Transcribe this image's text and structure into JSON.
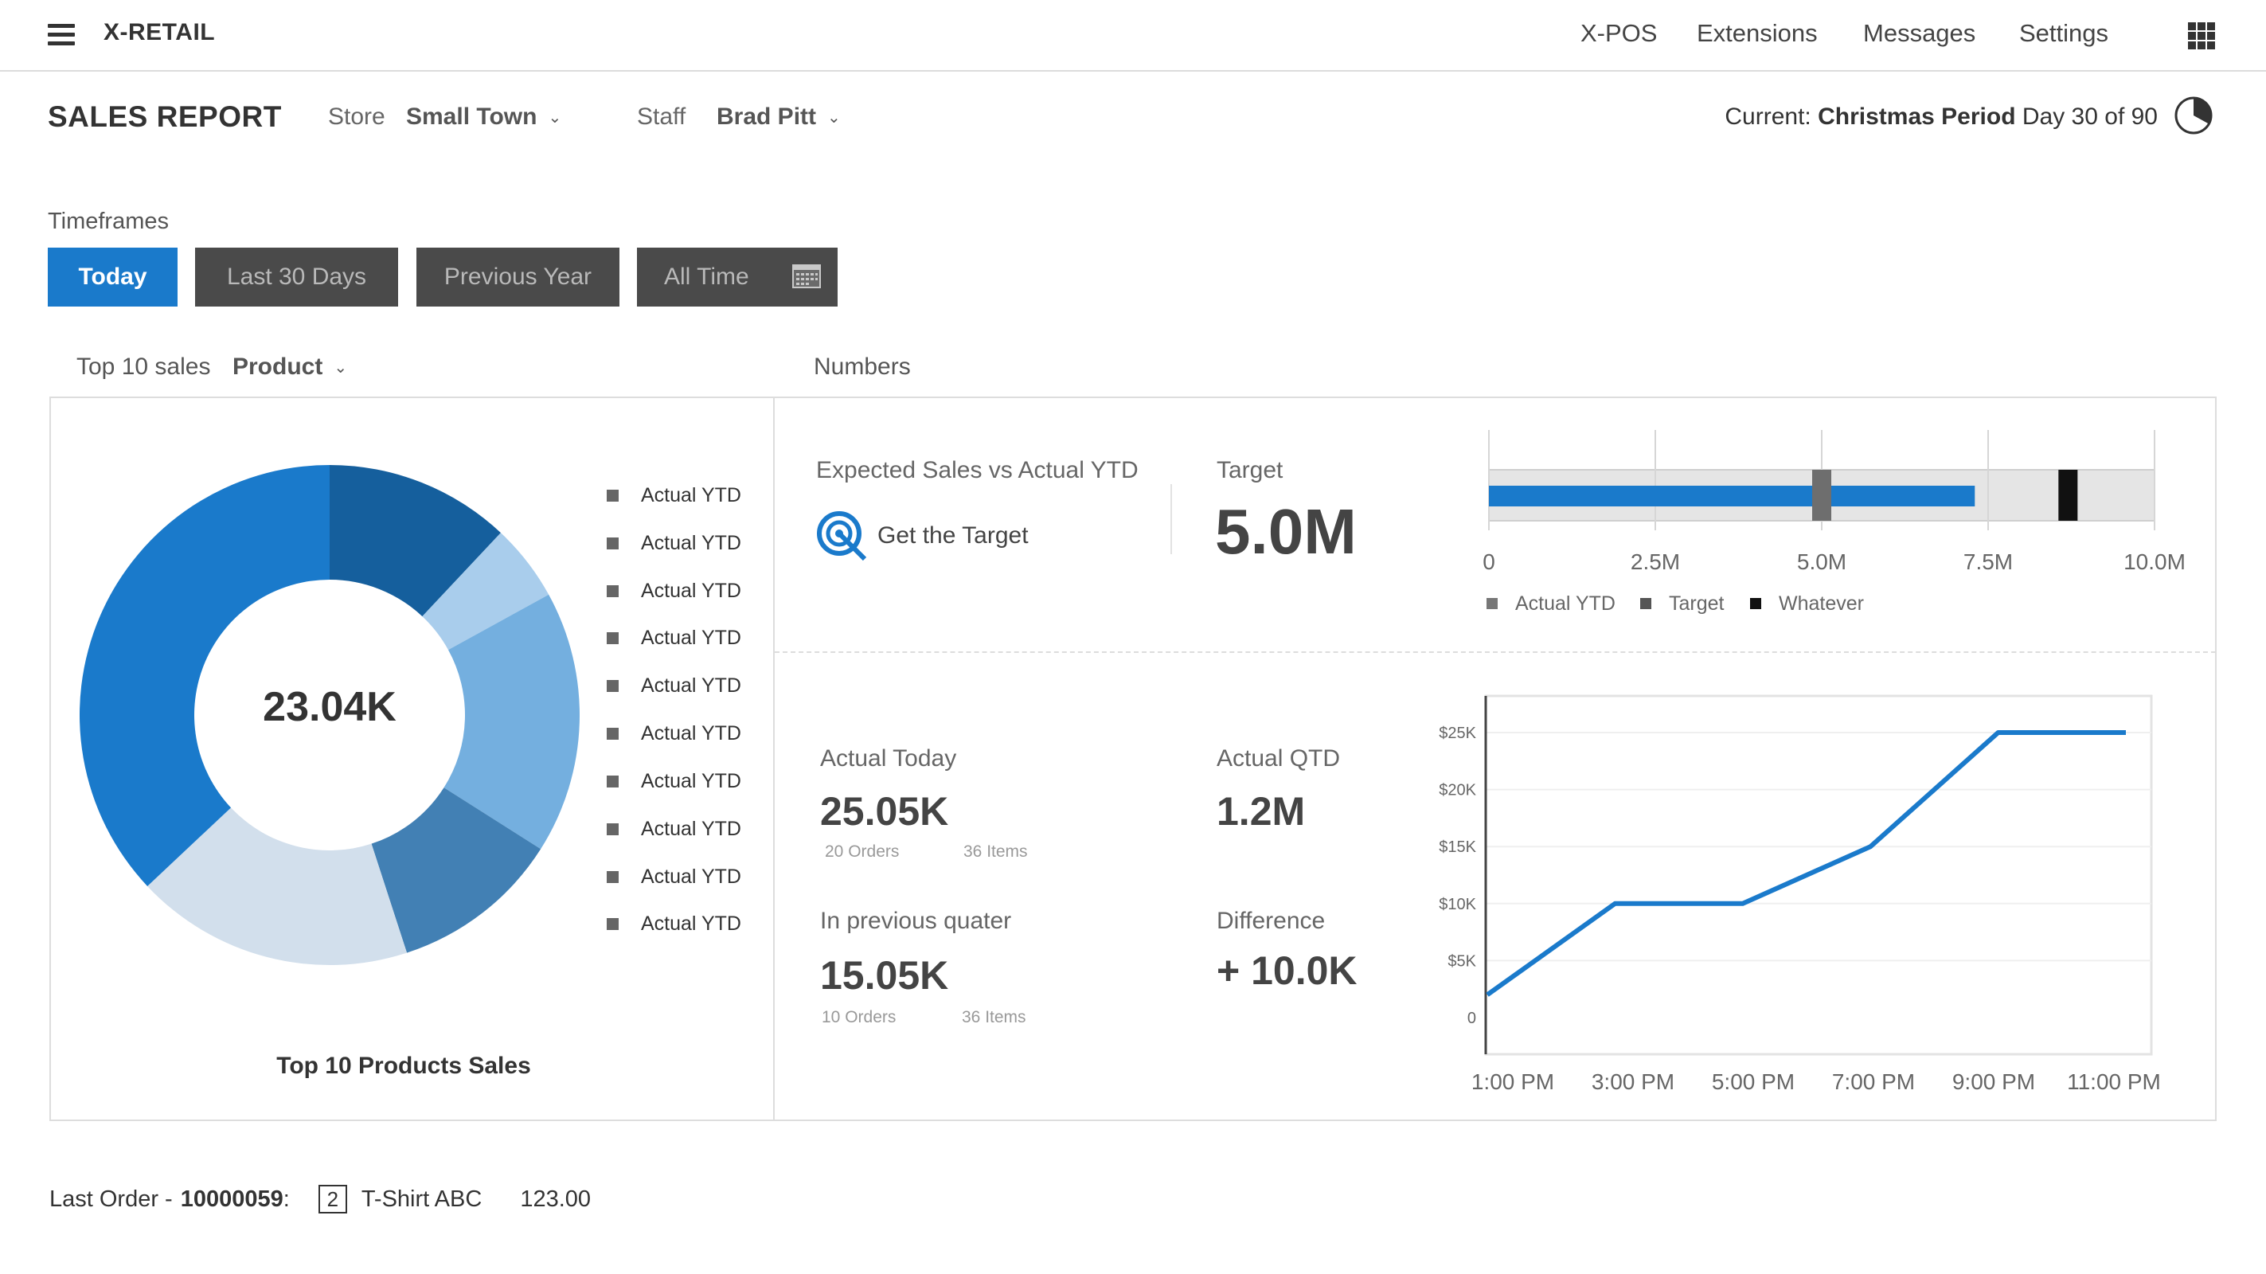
{
  "app": {
    "brand": "X-RETAIL",
    "nav": [
      "X-POS",
      "Extensions",
      "Messages",
      "Settings"
    ]
  },
  "header": {
    "title": "SALES REPORT",
    "store_label": "Store",
    "store_value": "Small Town",
    "staff_label": "Staff",
    "staff_value": "Brad Pitt",
    "current_prefix": "Current:",
    "current_period": "Christmas Period",
    "current_day": "Day 30 of 90",
    "period_progress": 0.33
  },
  "timeframes": {
    "label": "Timeframes",
    "buttons": [
      "Today",
      "Last 30 Days",
      "Previous Year",
      "All Time"
    ],
    "active": "Today"
  },
  "top_sales": {
    "label": "Top 10 sales",
    "dimension": "Product",
    "center_value": "23.04K",
    "caption": "Top 10 Products Sales",
    "legend": [
      "Actual YTD",
      "Actual YTD",
      "Actual YTD",
      "Actual YTD",
      "Actual YTD",
      "Actual YTD",
      "Actual YTD",
      "Actual YTD",
      "Actual YTD",
      "Actual YTD"
    ]
  },
  "numbers": {
    "label": "Numbers",
    "expected_label": "Expected Sales vs Actual YTD",
    "get_target": "Get the Target",
    "target_label": "Target",
    "target_value": "5.0M",
    "actual_today_label": "Actual Today",
    "actual_today_value": "25.05K",
    "actual_today_orders": "20 Orders",
    "actual_today_items": "36 Items",
    "actual_qtd_label": "Actual QTD",
    "actual_qtd_value": "1.2M",
    "prev_quarter_label": "In previous quater",
    "prev_quarter_value": "15.05K",
    "prev_quarter_orders": "10 Orders",
    "prev_quarter_items": "36 Items",
    "difference_label": "Difference",
    "difference_value": "+ 10.0K"
  },
  "footer": {
    "prefix": "Last Order -",
    "order_id": "10000059",
    "sep": ":",
    "qty": "2",
    "item": "T-Shirt ABC",
    "amount": "123.00"
  },
  "colors": {
    "accent": "#1a7acb",
    "dark_button": "#4a4a4a"
  },
  "chart_data": [
    {
      "type": "pie",
      "variant": "donut",
      "values": [
        12,
        5,
        17,
        11,
        18,
        37
      ],
      "colors": [
        "#155f9d",
        "#a9cdec",
        "#74afdf",
        "#4280b4",
        "#d2dfec",
        "#1a7acb"
      ],
      "center_label": "23.04K",
      "title": "Top 10 Products Sales"
    },
    {
      "type": "bar",
      "variant": "bullet",
      "xlim": [
        0,
        10
      ],
      "ticks": [
        "0",
        "2.5M",
        "5.0M",
        "7.5M",
        "10.0M"
      ],
      "actual": 7.3,
      "target": 5.0,
      "whatever": 8.7,
      "legend": [
        "Actual YTD",
        "Target",
        "Whatever"
      ],
      "legend_colors": [
        "#777777",
        "#555555",
        "#111111"
      ]
    },
    {
      "type": "line",
      "x": [
        "1:00 PM",
        "2:00 PM",
        "3:00 PM",
        "4:00 PM",
        "5:00 PM",
        "6:00 PM",
        "7:00 PM",
        "8:00 PM",
        "9:00 PM",
        "10:00 PM",
        "11:00 PM"
      ],
      "x_tick_labels": [
        "1:00 PM",
        "3:00 PM",
        "5:00 PM",
        "7:00 PM",
        "9:00 PM",
        "11:00 PM"
      ],
      "y_tick_labels": [
        "0",
        "$5K",
        "$10K",
        "$15K",
        "$20K",
        "$25K"
      ],
      "ylim": [
        0,
        27000
      ],
      "values": [
        2000,
        6000,
        10000,
        10000,
        10000,
        12500,
        15000,
        20000,
        25000,
        25000,
        25000
      ],
      "color": "#1a7acb",
      "grid": true
    }
  ]
}
